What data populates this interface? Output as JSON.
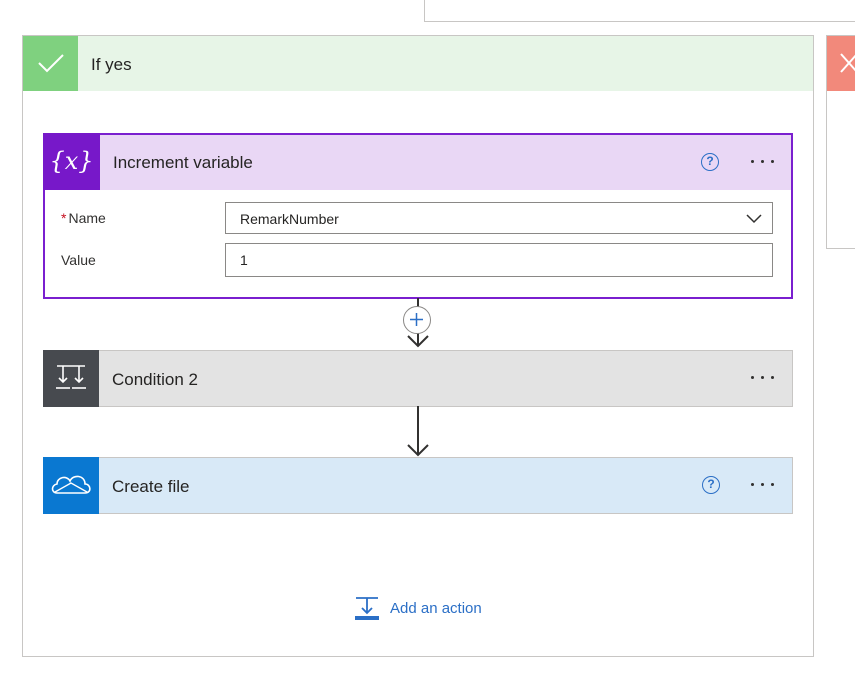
{
  "branch": {
    "title": "If yes"
  },
  "increment_variable": {
    "title": "Increment variable",
    "fields": [
      {
        "label": "Name",
        "required": true,
        "value": "RemarkNumber",
        "type": "dropdown"
      },
      {
        "label": "Value",
        "required": false,
        "value": "1",
        "type": "text"
      }
    ],
    "icon": "variable-icon",
    "accent": "#7718c9"
  },
  "condition2": {
    "title": "Condition 2",
    "icon": "condition-icon",
    "accent": "#474a4f"
  },
  "create_file": {
    "title": "Create file",
    "icon": "onedrive-cloud-icon",
    "accent": "#0a78d1"
  },
  "add_action": {
    "label": "Add an action"
  },
  "colors": {
    "yes_branch": "#7fd17f",
    "no_branch": "#f2897b",
    "link": "#2b6fc6"
  }
}
